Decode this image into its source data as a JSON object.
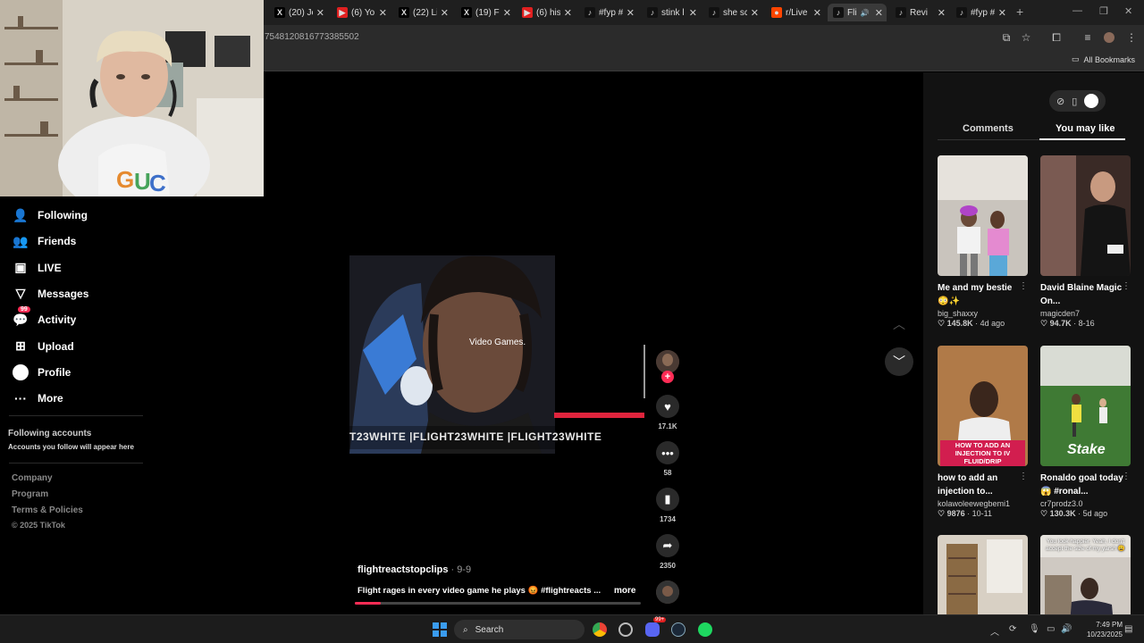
{
  "browser": {
    "tabs": [
      {
        "label": "(20) Je",
        "icon": "x-icon",
        "fav_color": "#000"
      },
      {
        "label": "(6) Yo",
        "icon": "youtube-icon",
        "fav_color": "#e02020"
      },
      {
        "label": "(22) Li",
        "icon": "x-icon",
        "fav_color": "#000"
      },
      {
        "label": "(19) Fr",
        "icon": "x-icon",
        "fav_color": "#000"
      },
      {
        "label": "(6) his",
        "icon": "youtube-icon",
        "fav_color": "#e02020"
      },
      {
        "label": "#fyp #",
        "icon": "tiktok-icon",
        "fav_color": "#111"
      },
      {
        "label": "stink l",
        "icon": "tiktok-icon",
        "fav_color": "#111"
      },
      {
        "label": "she sc",
        "icon": "tiktok-icon",
        "fav_color": "#111"
      },
      {
        "label": "r/Live",
        "icon": "reddit-icon",
        "fav_color": "#ff4500"
      },
      {
        "label": "Fli",
        "icon": "tiktok-icon",
        "fav_color": "#111",
        "active": true
      },
      {
        "label": "Revi",
        "icon": "tiktok-icon",
        "fav_color": "#111"
      },
      {
        "label": "#fyp #",
        "icon": "tiktok-icon",
        "fav_color": "#111"
      }
    ],
    "url": "7548120816773385502",
    "all_bookmarks": "All Bookmarks"
  },
  "sidebar": {
    "items": [
      {
        "label": "Following",
        "icon": "following-icon"
      },
      {
        "label": "Friends",
        "icon": "friends-icon"
      },
      {
        "label": "LIVE",
        "icon": "live-icon"
      },
      {
        "label": "Messages",
        "icon": "messages-icon"
      },
      {
        "label": "Activity",
        "icon": "activity-icon",
        "badge": "99"
      },
      {
        "label": "Upload",
        "icon": "upload-icon"
      },
      {
        "label": "Profile",
        "icon": "profile-icon"
      },
      {
        "label": "More",
        "icon": "more-icon"
      }
    ],
    "following_accounts_title": "Following accounts",
    "following_accounts_sub": "Accounts you follow will appear here",
    "footer": [
      "Company",
      "Program",
      "Terms & Policies",
      "© 2025 TikTok"
    ]
  },
  "video": {
    "caption": "Video Games.",
    "watermark": "T23WHITE  |FLIGHT23WHITE  |FLIGHT23WHITE",
    "author": "flightreactstopclips",
    "date": " · 9-9",
    "description": "Flight rages in every video game he plays 😡 #flightreacts ...",
    "more": "more",
    "progress_fraction": 0.09,
    "actions": {
      "likes": "17.1K",
      "comments": "58",
      "saves": "1734",
      "shares": "2350"
    }
  },
  "right_panel": {
    "tabs": [
      "Comments",
      "You may like"
    ],
    "active_tab": "You may like",
    "cards": [
      {
        "title": "Me and my bestie 😳✨",
        "user": "big_shaxxy",
        "likes": "145.8K",
        "ago": " · 4d ago"
      },
      {
        "title": "David Blaine Magic On...",
        "user": "magicden7",
        "likes": "94.7K",
        "ago": " · 8-16"
      },
      {
        "title": "how to add an injection to...",
        "user": "kolawoleewegbemi1",
        "likes": "9876",
        "ago": " · 10-11",
        "overlay": "HOW TO ADD AN INJECTION TO IV FLUID/DRIP"
      },
      {
        "title": "Ronaldo goal today 😱 #ronal...",
        "user": "cr7prodz3.0",
        "likes": "130.3K",
        "ago": " · 5d ago",
        "overlay": "Stake"
      },
      {
        "title": "",
        "user": "",
        "likes": "",
        "ago": ""
      },
      {
        "title": "",
        "user": "",
        "likes": "",
        "ago": "",
        "overlay": "You look happier. Yeah, I don't accept the size of my yarsh 😩"
      }
    ]
  },
  "taskbar": {
    "search": "Search",
    "time": "7:49 PM",
    "date": "10/23/2025",
    "notification_badge": "99+"
  }
}
